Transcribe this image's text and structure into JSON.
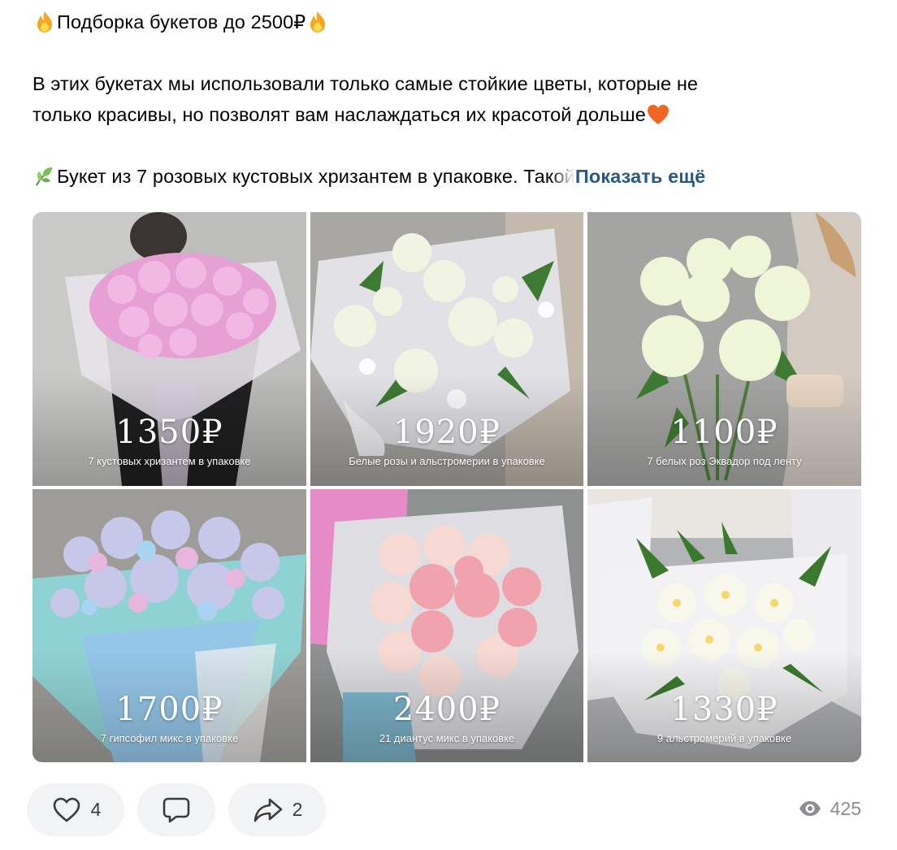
{
  "post": {
    "title": "Подборка букетов до 2500₽",
    "title_emoji": "fire-icon",
    "paragraph_line1": "В этих букетах мы использовали только самые стойкие цветы, которые не",
    "paragraph_line2": "только красивы, но позволят вам наслаждаться их красотой дольше",
    "paragraph_emoji": "heart-icon",
    "item_line": "Букет из 7 розовых кустовых хризантем в упаковке. Такой",
    "item_emoji": "leaf-icon",
    "show_more": "Показать ещё"
  },
  "gallery": {
    "tiles": [
      {
        "price": "1350₽",
        "caption": "7 кустовых хризантем в упаковке",
        "flower_color": "#e9a4d6"
      },
      {
        "price": "1920₽",
        "caption": "Белые розы и альстромерии в упаковке",
        "flower_color": "#f2f5e4"
      },
      {
        "price": "1100₽",
        "caption": "7 белых роз Эквадор под ленту",
        "flower_color": "#f1f6dc"
      },
      {
        "price": "1700₽",
        "caption": "7 гипсофил микс в упаковке",
        "flower_color": "#c6cbe8"
      },
      {
        "price": "2400₽",
        "caption": "21 диантус микс в упаковке",
        "flower_color": "#f2a9b2"
      },
      {
        "price": "1330₽",
        "caption": "9 альстромерий в упаковке",
        "flower_color": "#f7f5e8"
      }
    ]
  },
  "actions": {
    "likes": "4",
    "shares": "2",
    "views": "425"
  },
  "colors": {
    "link": "#2a5885",
    "pill_bg": "#f2f3f5",
    "muted": "#8a8d91"
  }
}
